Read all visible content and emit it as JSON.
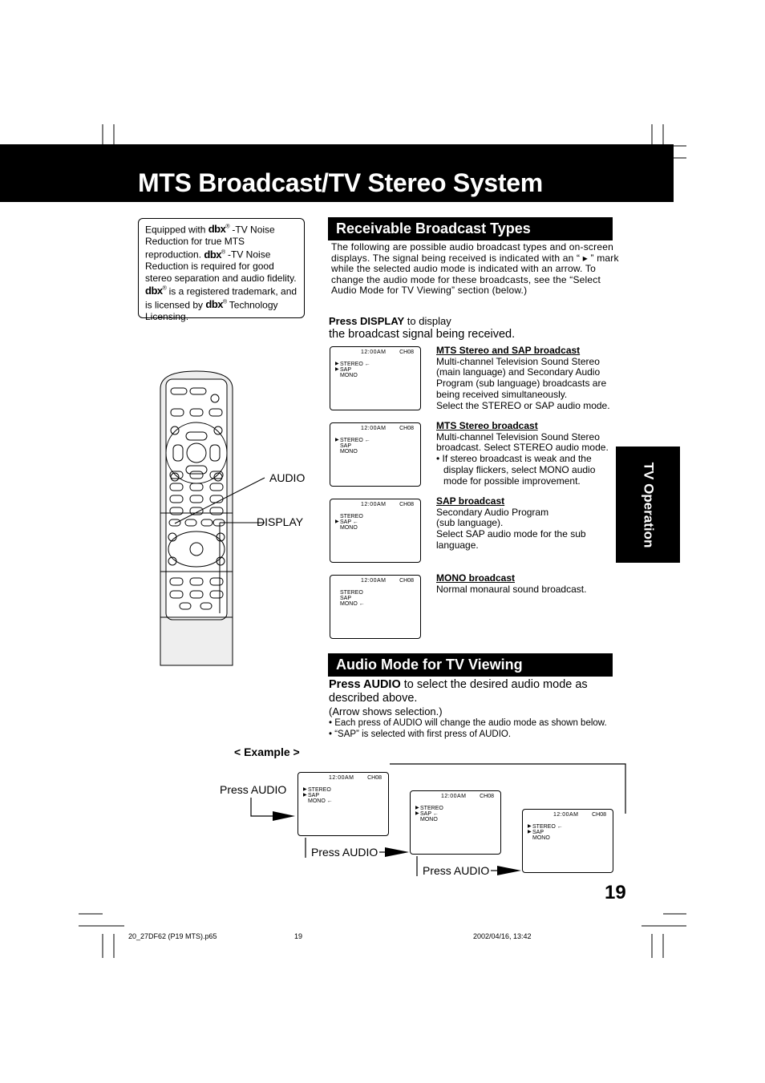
{
  "title": "MTS Broadcast/TV Stereo System",
  "dbx_note": {
    "logo": "dbx",
    "registered": "®",
    "line1_a": "Equipped with ",
    "line1_b": " -TV Noise Reduction for true MTS reproduction. ",
    "line2_b": " -TV Noise Reduction is required for good stereo separation and audio fidelity. ",
    "line3_b": " is a registered trademark, and is licensed by ",
    "line4_b": " Technology Licensing."
  },
  "receivable": {
    "heading": "Receivable Broadcast Types",
    "intro": "The following are possible audio broadcast types and on-screen displays. The signal being received is indicated with an “ ▸ ” mark while the selected audio mode is indicated with an arrow. To change the audio mode for these broadcasts, see the “Select Audio Mode for TV Viewing” section  (below.)",
    "press_bold": "Press DISPLAY",
    "press_rest": " to display",
    "press_line2": "the broadcast signal being received.",
    "types": [
      {
        "heading": "MTS Stereo and SAP broadcast",
        "body": [
          "Multi-channel Television Sound Stereo (main language) and Secondary Audio Program (sub language) broadcasts are being received simultaneously.",
          "Select the STEREO or SAP audio mode."
        ]
      },
      {
        "heading": "MTS Stereo broadcast",
        "body": [
          "Multi-channel Television Sound Stereo broadcast. Select STEREO audio mode.",
          "• If stereo broadcast is weak and the display flickers, select MONO audio mode for possible improvement."
        ]
      },
      {
        "heading": "SAP broadcast",
        "body": [
          "Secondary Audio Program",
          "(sub language).",
          "Select SAP audio mode for the sub language."
        ]
      },
      {
        "heading": "MONO broadcast",
        "body": [
          "Normal monaural sound broadcast."
        ]
      }
    ]
  },
  "screens": {
    "clock": "12:00AM",
    "channel": "CH08",
    "received_mark": "▶",
    "selected_mark": "←",
    "type_screens": [
      [
        {
          "label": "STEREO",
          "received": true,
          "selected": true
        },
        {
          "label": "SAP",
          "received": true,
          "selected": false
        },
        {
          "label": "MONO",
          "received": false,
          "selected": false
        }
      ],
      [
        {
          "label": "STEREO",
          "received": true,
          "selected": true
        },
        {
          "label": "SAP",
          "received": false,
          "selected": false
        },
        {
          "label": "MONO",
          "received": false,
          "selected": false
        }
      ],
      [
        {
          "label": "STEREO",
          "received": false,
          "selected": false
        },
        {
          "label": "SAP",
          "received": true,
          "selected": true
        },
        {
          "label": "MONO",
          "received": false,
          "selected": false
        }
      ],
      [
        {
          "label": "STEREO",
          "received": false,
          "selected": false
        },
        {
          "label": "SAP",
          "received": false,
          "selected": false
        },
        {
          "label": "MONO",
          "received": false,
          "selected": true
        }
      ]
    ],
    "example_screens": [
      [
        {
          "label": "STEREO",
          "received": true,
          "selected": false
        },
        {
          "label": "SAP",
          "received": true,
          "selected": false
        },
        {
          "label": "MONO",
          "received": false,
          "selected": true
        }
      ],
      [
        {
          "label": "STEREO",
          "received": true,
          "selected": false
        },
        {
          "label": "SAP",
          "received": true,
          "selected": true
        },
        {
          "label": "MONO",
          "received": false,
          "selected": false
        }
      ],
      [
        {
          "label": "STEREO",
          "received": true,
          "selected": true
        },
        {
          "label": "SAP",
          "received": true,
          "selected": false
        },
        {
          "label": "MONO",
          "received": false,
          "selected": false
        }
      ]
    ]
  },
  "audio_mode": {
    "heading": "Audio Mode for TV Viewing",
    "press_bold": "Press AUDIO",
    "press_rest": " to select the desired audio mode as described above.",
    "arrow_note": "(Arrow shows selection.)",
    "bullets": [
      "• Each press of AUDIO will change the audio mode as shown below.",
      "• “SAP” is selected with first press of AUDIO."
    ]
  },
  "example": {
    "label": "< Example >",
    "press_audio": "Press AUDIO"
  },
  "remote": {
    "audio_label": "AUDIO",
    "display_label": "DISPLAY"
  },
  "side_tab": "TV Operation",
  "page_number": "19",
  "footer": {
    "file": "20_27DF62 (P19 MTS).p65",
    "page": "19",
    "timestamp": "2002/04/16, 13:42"
  }
}
